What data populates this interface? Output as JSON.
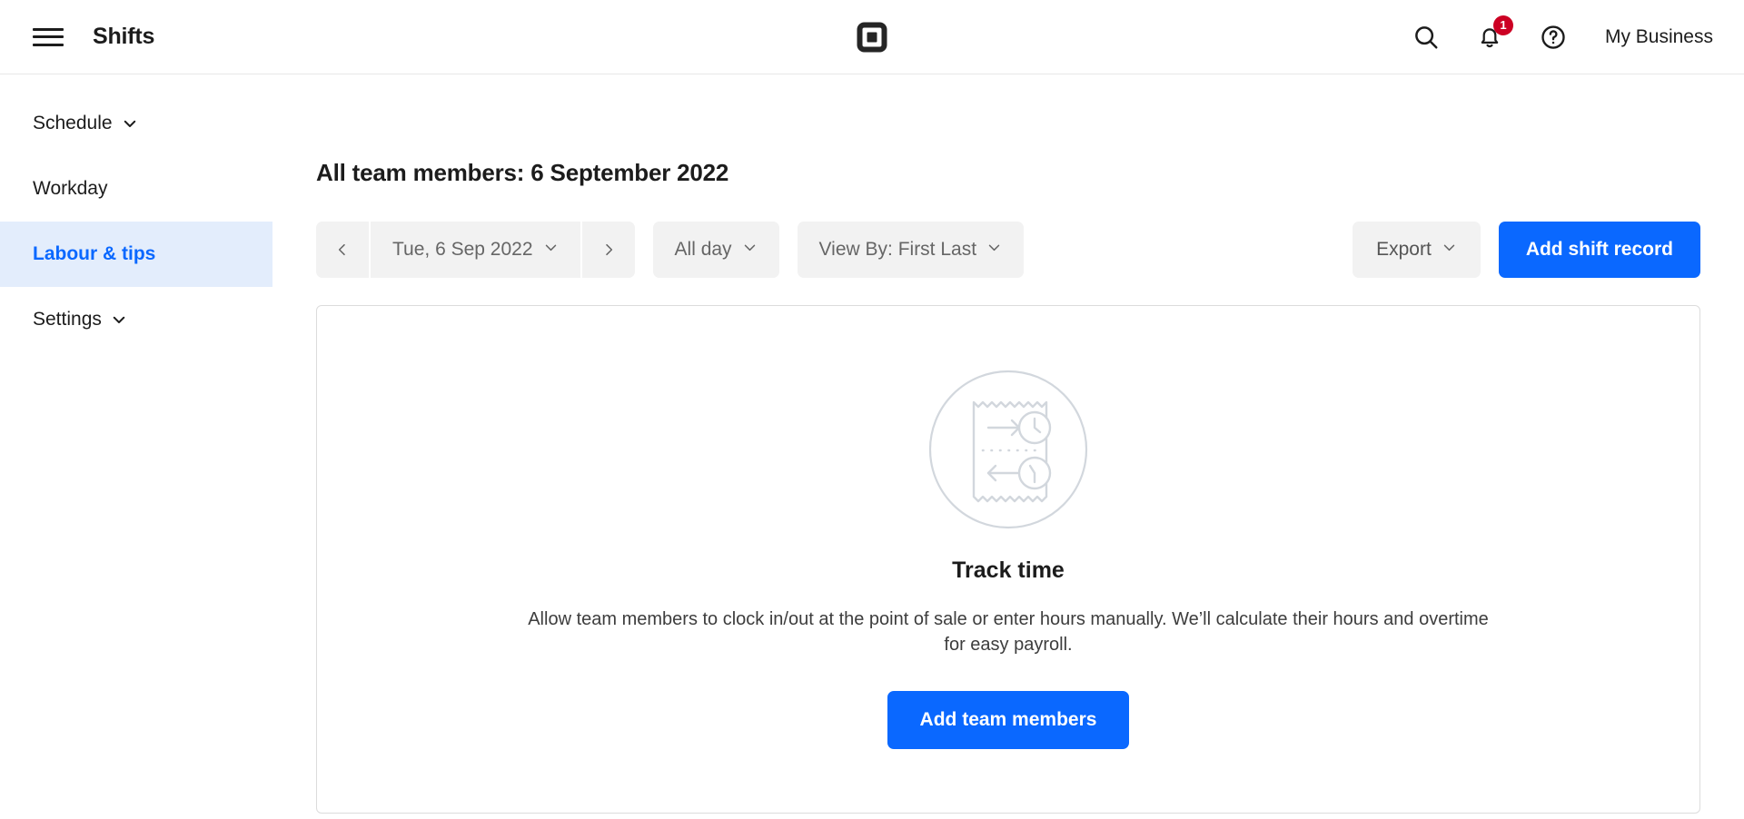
{
  "header": {
    "menu_icon": "hamburger-menu-icon",
    "app_title": "Shifts",
    "logo": "square-logo",
    "search_icon": "search-icon",
    "notifications_icon": "bell-icon",
    "notifications_count": "1",
    "help_icon": "help-circle-icon",
    "business_name": "My Business"
  },
  "sidebar": {
    "items": [
      {
        "label": "Schedule",
        "has_chevron": true,
        "active": false
      },
      {
        "label": "Workday",
        "has_chevron": false,
        "active": false
      },
      {
        "label": "Labour & tips",
        "has_chevron": false,
        "active": true
      },
      {
        "label": "Settings",
        "has_chevron": true,
        "active": false
      }
    ]
  },
  "main": {
    "page_title": "All team members: 6 September 2022",
    "toolbar": {
      "prev_label": "‹",
      "date_value": "Tue, 6 Sep 2022",
      "next_label": "›",
      "all_day_label": "All day",
      "view_by_label": "View By: First Last",
      "export_label": "Export",
      "add_shift_record_label": "Add shift record"
    },
    "empty_state": {
      "illustration": "receipt-clock-in-out-illustration",
      "title": "Track time",
      "description": "Allow team members to clock in/out at the point of sale or enter hours manually. We’ll calculate their hours and overtime for easy payroll.",
      "cta_label": "Add team members"
    }
  },
  "colors": {
    "accent_blue": "#0a68ff",
    "active_nav_bg": "#e3edfc",
    "badge_red": "#cc0023",
    "pill_grey": "#f2f2f2",
    "illustration_grey": "#ccd2d9"
  }
}
